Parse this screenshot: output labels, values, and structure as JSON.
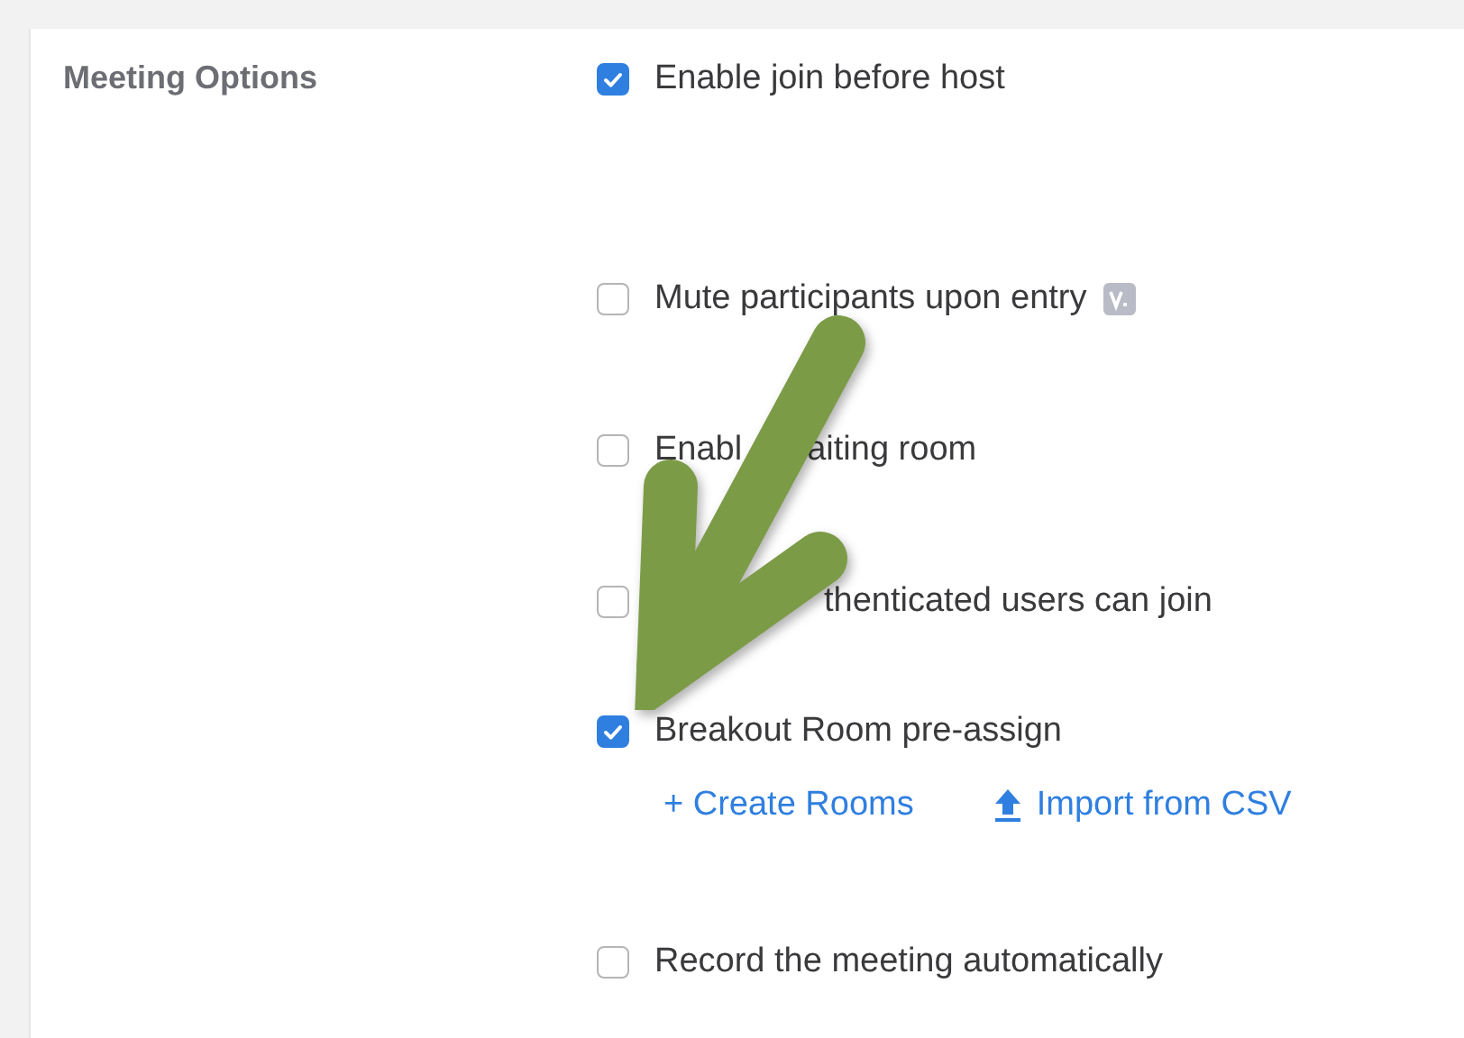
{
  "section": {
    "label": "Meeting Options"
  },
  "options": [
    {
      "label_parts": [
        "Enable join before host"
      ],
      "checked": true
    },
    {
      "label_parts": [
        "Mute participants upon entry"
      ],
      "checked": false,
      "badge": true
    },
    {
      "label_parts": [
        "Enabl",
        "aiting room"
      ],
      "checked": false
    },
    {
      "label_parts": [
        "thenticated users can join"
      ],
      "leading_covered": true,
      "checked": false
    },
    {
      "label_parts": [
        "Breakout Room pre-assign"
      ],
      "checked": true,
      "links": [
        {
          "kind": "add",
          "label": "+ Create Rooms"
        },
        {
          "kind": "upload",
          "label": "Import from CSV"
        }
      ]
    },
    {
      "label_parts": [
        "Record the meeting automatically"
      ],
      "checked": false
    }
  ]
}
